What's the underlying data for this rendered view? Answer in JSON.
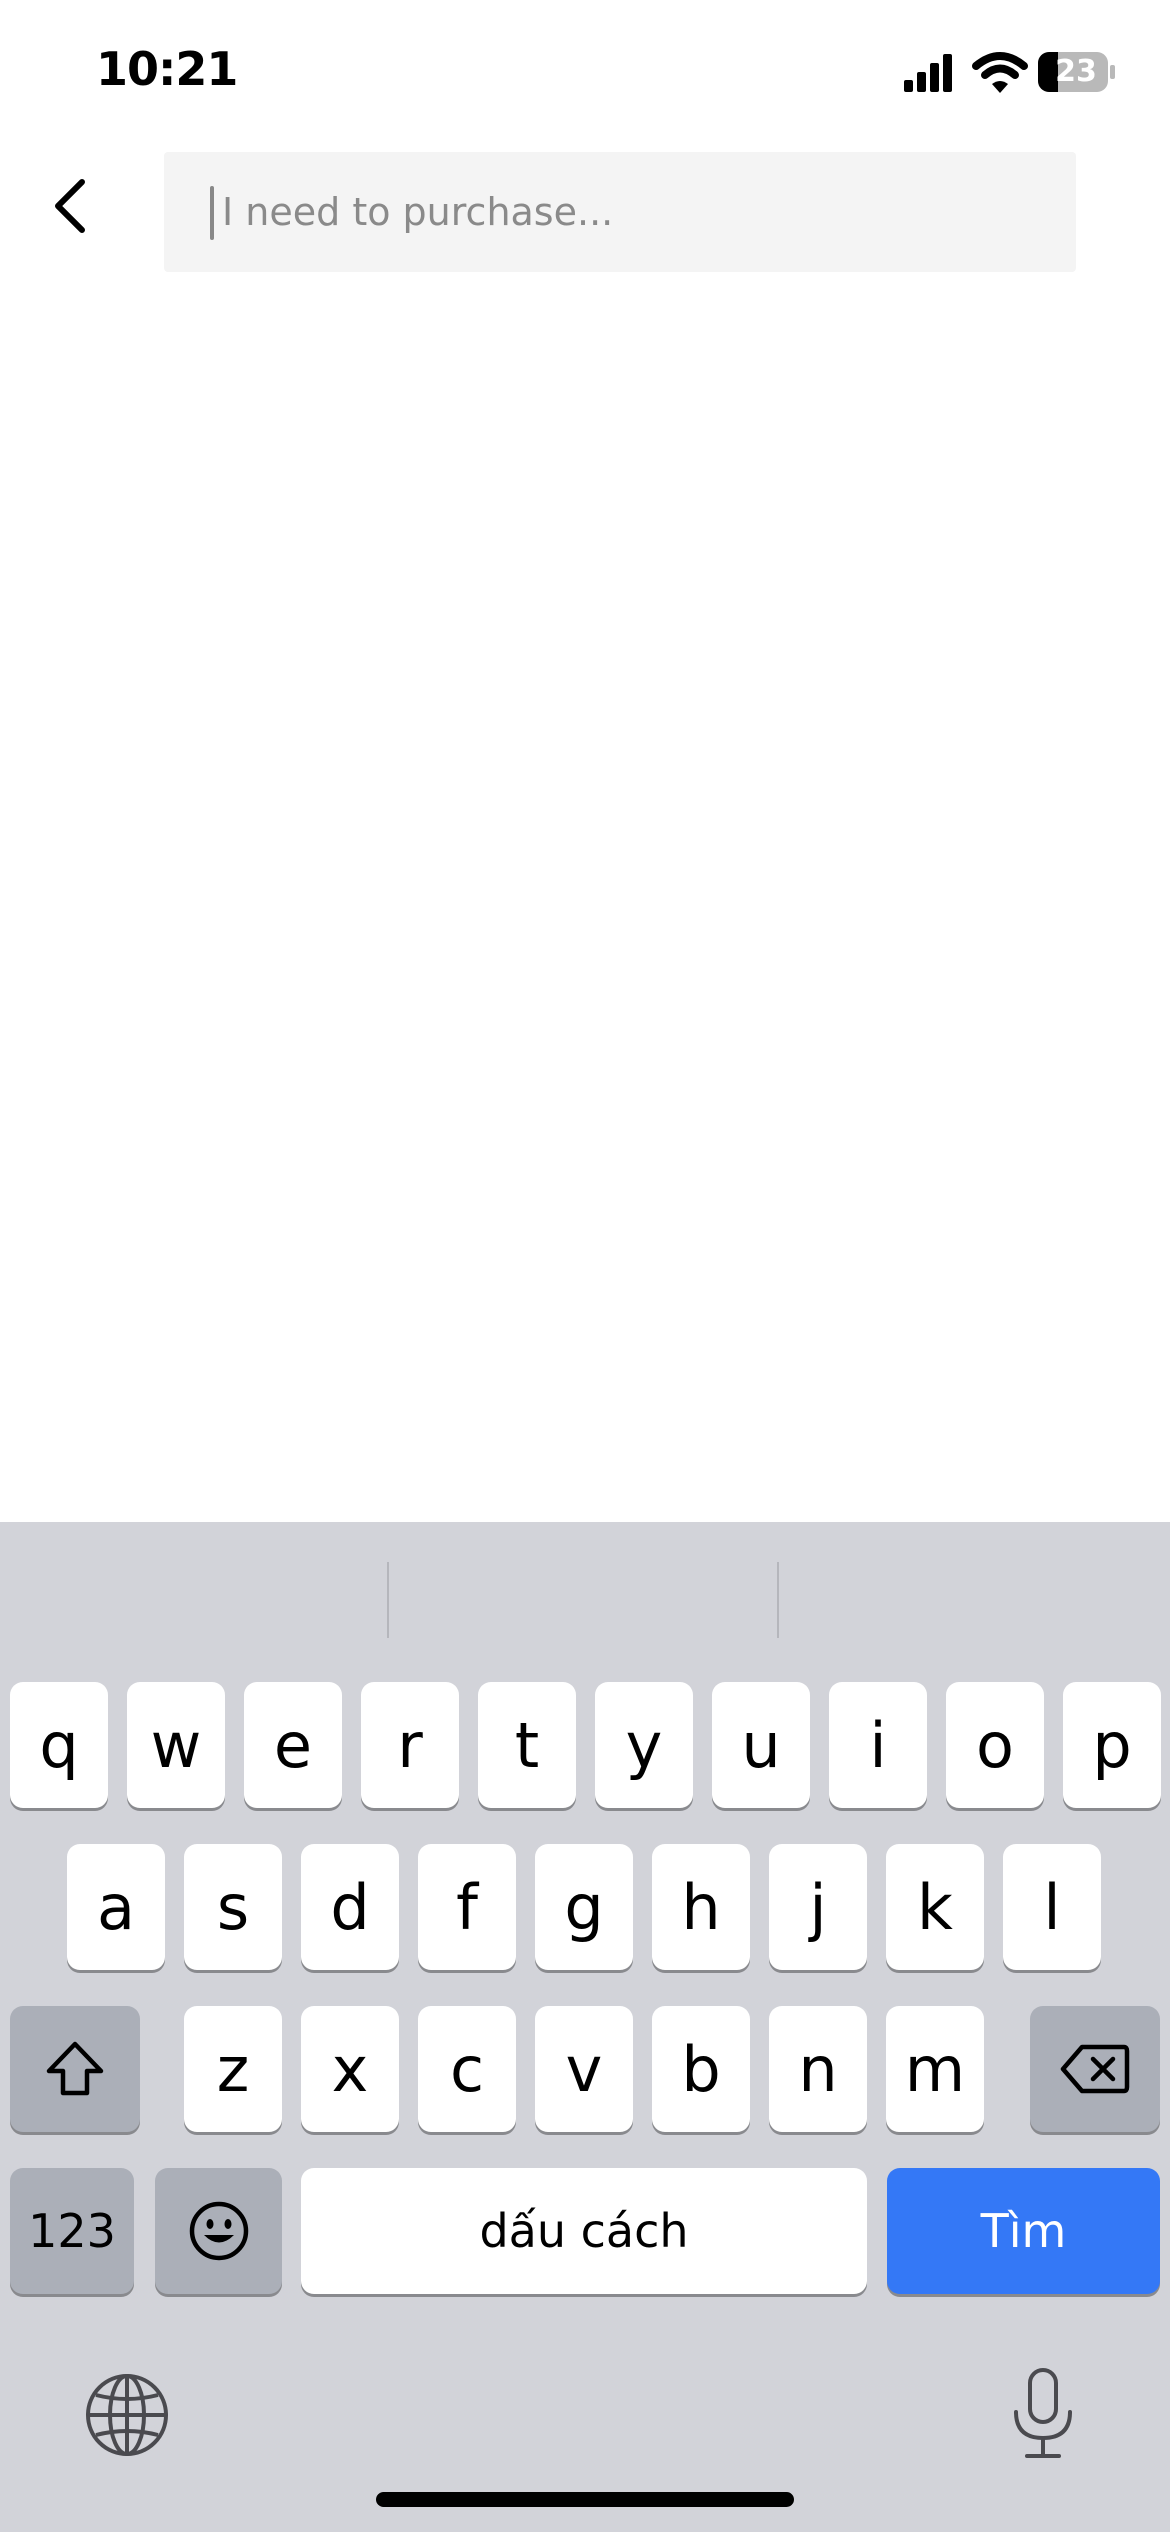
{
  "status_bar": {
    "time": "10:21",
    "battery": "23",
    "icons": [
      "signal-icon",
      "wifi-icon",
      "battery-icon"
    ]
  },
  "header": {
    "back_icon": "chevron-left-icon",
    "search_placeholder": "I need to purchase..."
  },
  "keyboard": {
    "row1": [
      "q",
      "w",
      "e",
      "r",
      "t",
      "y",
      "u",
      "i",
      "o",
      "p"
    ],
    "row2": [
      "a",
      "s",
      "d",
      "f",
      "g",
      "h",
      "j",
      "k",
      "l"
    ],
    "row3": [
      "z",
      "x",
      "c",
      "v",
      "b",
      "n",
      "m"
    ],
    "numbers_label": "123",
    "space_label": "dấu cách",
    "return_label": "Tìm",
    "accent_color": "#3478f6",
    "icons": [
      "shift-icon",
      "backspace-icon",
      "emoji-icon",
      "globe-icon",
      "microphone-icon"
    ]
  }
}
